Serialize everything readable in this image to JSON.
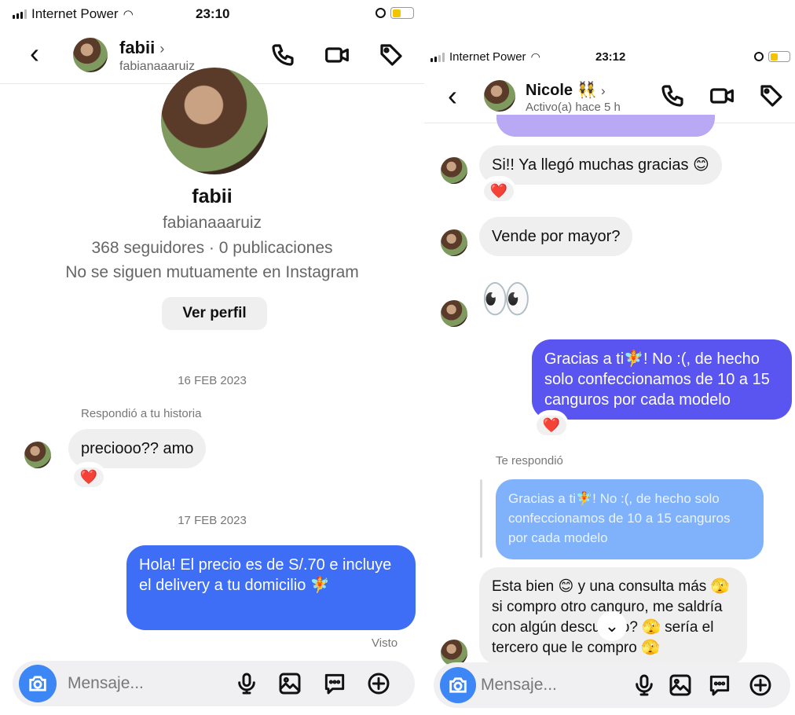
{
  "left": {
    "status": {
      "carrier": "Internet Power",
      "time": "23:10"
    },
    "header": {
      "name": "fabii",
      "username": "fabianaaaruiz"
    },
    "profile": {
      "name": "fabii",
      "username": "fabianaaaruiz",
      "stats": "368 seguidores · 0 publicaciones",
      "mutual": "No se siguen mutuamente en Instagram",
      "view_profile": "Ver perfil"
    },
    "messages": {
      "date1": "16 FEB 2023",
      "replied_story": "Respondió a tu historia",
      "msg1": "preciooo?? amo",
      "msg1_reaction": "❤️",
      "date2": "17 FEB 2023",
      "msg2": "Hola! El precio es de S/.70 e incluye el delivery a tu domicilio 🧚",
      "seen": "Visto"
    },
    "composer": {
      "placeholder": "Mensaje..."
    }
  },
  "right": {
    "status": {
      "carrier": "Internet Power",
      "time": "23:12"
    },
    "header": {
      "name": "Nicole 👯",
      "activity": "Activo(a) hace 5 h"
    },
    "messages": {
      "msg1": "Si!! Ya llegó muchas gracias 😊",
      "msg1_reaction": "❤️",
      "msg2": "Vende por mayor?",
      "msg3": "👀",
      "msg4": "Gracias a ti🧚! No :(, de hecho solo confeccionamos de 10 a 15 canguros por cada modelo",
      "msg4_reaction": "❤️",
      "replied_label": "Te respondió",
      "quoted": "Gracias a ti🧚! No :(, de hecho solo confeccionamos de 10 a 15 canguros por cada modelo",
      "msg5": "Esta bien 😊 y una consulta más 🫣 si compro otro canguro, me saldría con algún descuento? 🫣 sería el tercero que le compro 🫣"
    },
    "composer": {
      "placeholder": "Mensaje..."
    }
  },
  "colors": {
    "accent": "#3e6ef6",
    "purple": "#5a55f0",
    "camera": "#3c86f5",
    "reaction": "#e0222a"
  }
}
